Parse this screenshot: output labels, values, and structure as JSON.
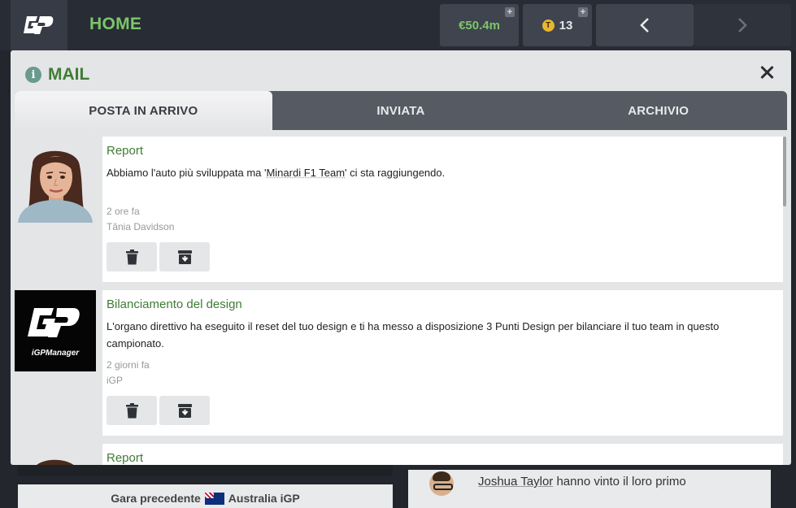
{
  "topbar": {
    "home_label": "HOME",
    "money": "€50.4m",
    "tokens": "13",
    "plus_symbol": "+",
    "token_symbol": "T"
  },
  "background": {
    "previous_race_label": "Gara precedente",
    "previous_race_name": "Australia iGP",
    "news_name": "Joshua Taylor",
    "news_text": "hanno vinto il loro primo"
  },
  "modal": {
    "title": "MAIL",
    "info_symbol": "i",
    "tabs": [
      {
        "label": "POSTA IN ARRIVO",
        "active": true
      },
      {
        "label": "INVIATA",
        "active": false
      },
      {
        "label": "ARCHIVIO",
        "active": false
      }
    ],
    "mails": [
      {
        "subject": "Report",
        "body_before": "Abbiamo l'auto più sviluppata ma '",
        "body_link": "Minardi F1 Team",
        "body_after": "' ci sta raggiungendo.",
        "time": "2 ore fa",
        "sender": "Tânia Davidson",
        "avatar": "woman-avatar"
      },
      {
        "subject": "Bilanciamento del design",
        "body": "L'organo direttivo ha eseguito il reset del tuo design e ti ha messo a disposizione 3 Punti Design per bilanciare il tuo team in questo campionato.",
        "time": "2 giorni fa",
        "sender": "iGP",
        "avatar": "igp-logo",
        "logo_text": "iGPManager"
      },
      {
        "subject": "Report"
      }
    ]
  },
  "colors": {
    "accent_green": "#3f7d35",
    "home_green": "#7cc66b",
    "topbar": "#282c34"
  },
  "icons": [
    "igp-logo-icon",
    "plus-icon",
    "token-icon",
    "chevron-left-icon",
    "chevron-right-icon",
    "info-icon",
    "close-icon",
    "trash-icon",
    "archive-icon"
  ]
}
